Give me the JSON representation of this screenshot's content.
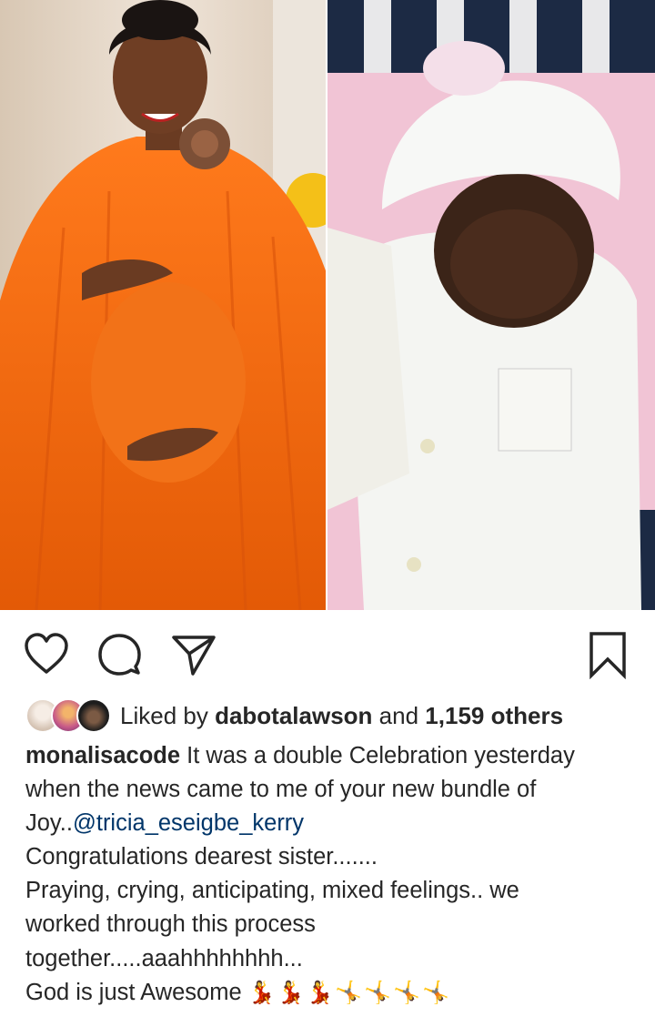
{
  "post": {
    "liked_by_prefix": "Liked by",
    "liked_by_user": "dabotalawson",
    "liked_and": "and",
    "liked_count": "1,159 others",
    "caption": {
      "username": "monalisacode",
      "line1_text": "It was a double Celebration yesterday",
      "line2": "when the news came to me of your new bundle of",
      "line3_prefix": "Joy..",
      "line3_mention": "@tricia_eseigbe_kerry",
      "line4": "Congratulations dearest sister.......",
      "line5": "Praying, crying, anticipating, mixed feelings.. we",
      "line6": "worked through this process",
      "line7": "together.....aaahhhhhhhh...",
      "line8_text": "God is just Awesome",
      "line8_emoji": "💃💃💃🤸🤸🤸🤸"
    }
  },
  "icons": {
    "like": "heart-icon",
    "comment": "comment-icon",
    "share": "share-icon",
    "save": "bookmark-icon"
  },
  "colors": {
    "text": "#262626",
    "mention": "#003569",
    "dress": "#f26a11"
  }
}
